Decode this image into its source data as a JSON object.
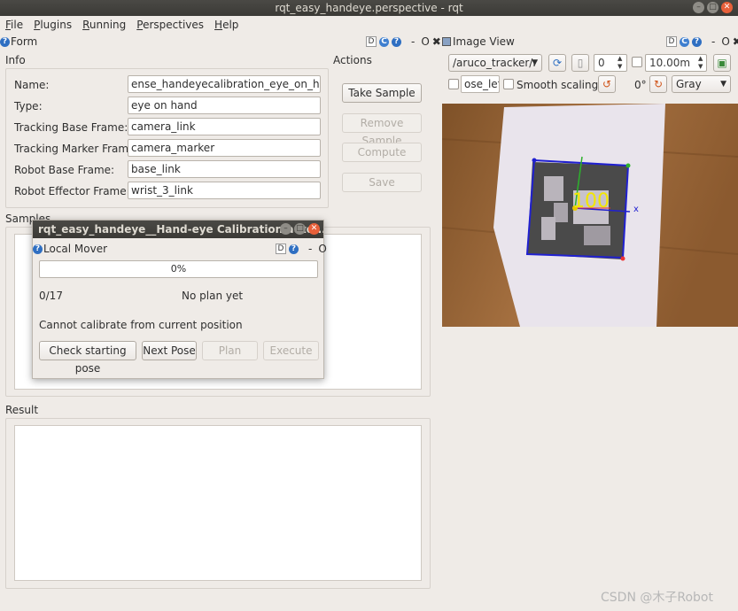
{
  "window": {
    "title": "rqt_easy_handeye.perspective - rqt"
  },
  "menu": [
    {
      "label": "File",
      "key": "F",
      "rest": "ile"
    },
    {
      "label": "Plugins",
      "key": "P",
      "rest": "lugins"
    },
    {
      "label": "Running",
      "key": "R",
      "rest": "unning"
    },
    {
      "label": "Perspectives",
      "key": "P",
      "rest": "erspectives"
    },
    {
      "label": "Help",
      "key": "H",
      "rest": "elp"
    }
  ],
  "form_dock": {
    "title": "Form",
    "info_label": "Info",
    "actions_label": "Actions",
    "fields": [
      {
        "label": "Name:",
        "value": "ense_handeyecalibration_eye_on_hand/"
      },
      {
        "label": "Type:",
        "value": "eye on hand"
      },
      {
        "label": "Tracking Base Frame:",
        "value": "camera_link"
      },
      {
        "label": "Tracking Marker Frame:",
        "value": "camera_marker"
      },
      {
        "label": "Robot Base Frame:",
        "value": "base_link"
      },
      {
        "label": "Robot Effector Frame:",
        "value": "wrist_3_link"
      }
    ],
    "buttons": {
      "take_sample": "Take Sample",
      "remove_sample": "Remove Sample",
      "compute": "Compute",
      "save": "Save"
    },
    "samples_label": "Samples",
    "result_label": "Result"
  },
  "image_dock": {
    "title": "Image View",
    "topic": "/aruco_tracker/r",
    "spin_value": "0",
    "max_range": "10.00m",
    "mouse_pub": "ose_left",
    "smooth_label": "Smooth scaling",
    "rotation": "0°",
    "color_scheme": "Gray",
    "marker_text": "100"
  },
  "dialog": {
    "title": "rqt_easy_handeye__Hand-eye Calibration auto...",
    "panel_title": "Local Mover",
    "progress": "0%",
    "counter": "0/17",
    "plan_status": "No plan yet",
    "message": "Cannot calibrate from current position",
    "buttons": {
      "check": "Check starting pose",
      "next": "Next Pose",
      "plan": "Plan",
      "execute": "Execute"
    }
  },
  "dock_controls": {
    "d": "D",
    "minus": "-",
    "o": "O",
    "x": "✖"
  },
  "watermark": "CSDN @木子Robot",
  "colors": {
    "accent": "#2f6fc2",
    "title_bar": "#3b3a36",
    "close": "#e8603a"
  }
}
